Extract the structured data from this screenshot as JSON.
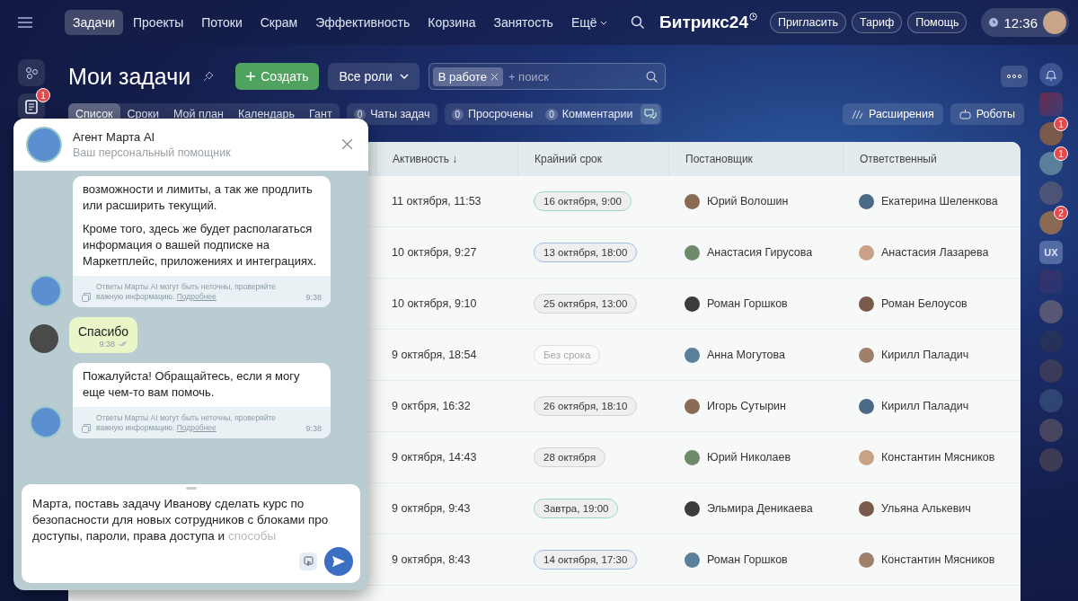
{
  "top_nav": {
    "items": [
      {
        "label": "Задачи",
        "selected": true,
        "dropdown": false
      },
      {
        "label": "Проекты",
        "selected": false,
        "dropdown": false
      },
      {
        "label": "Потоки",
        "selected": false,
        "dropdown": false
      },
      {
        "label": "Скрам",
        "selected": false,
        "dropdown": false
      },
      {
        "label": "Эффективность",
        "selected": false,
        "dropdown": false
      },
      {
        "label": "Корзина",
        "selected": false,
        "dropdown": false
      },
      {
        "label": "Занятость",
        "selected": false,
        "dropdown": false
      },
      {
        "label": "Ещё",
        "selected": false,
        "dropdown": true
      }
    ],
    "logo": "Битрикс24",
    "buttons": [
      "Пригласить",
      "Тариф",
      "Помощь"
    ],
    "time": "12:36"
  },
  "left_sidebar": {
    "items": [
      {
        "kind": "network"
      },
      {
        "kind": "tasks",
        "badge": "1"
      }
    ]
  },
  "header": {
    "title": "Мои задачи",
    "create_button": "Создать",
    "roles_button": "Все роли",
    "filter": {
      "chip": "В работе",
      "placeholder": "+ поиск"
    }
  },
  "view_tabs": [
    {
      "label": "Список",
      "selected": true
    },
    {
      "label": "Сроки",
      "selected": false
    },
    {
      "label": "Мой план",
      "selected": false
    },
    {
      "label": "Календарь",
      "selected": false
    },
    {
      "label": "Гант",
      "selected": false
    }
  ],
  "counters": [
    {
      "count": "0",
      "label": "Чаты задач"
    },
    {
      "count": "0",
      "label": "Просрочены"
    },
    {
      "count": "0",
      "label": "Комментарии"
    }
  ],
  "right_buttons": [
    "Расширения",
    "Роботы"
  ],
  "table": {
    "columns": [
      "Активность ↓",
      "Крайний срок",
      "Постановщик",
      "Ответственный"
    ],
    "rows": [
      {
        "activity": "11 октября, 11:53",
        "deadline": "16 октября, 9:00",
        "color": "#9fd6cc",
        "empty": false,
        "creator": "Юрий Волошин",
        "assignee": "Екатерина Шеленкова"
      },
      {
        "activity": "10 октября, 9:27",
        "deadline": "13 октября, 18:00",
        "color": "#9cc0e6",
        "empty": false,
        "creator": "Анастасия Гирусова",
        "assignee": "Анастасия Лазарева"
      },
      {
        "activity": "10 октября, 9:10",
        "deadline": "25 октября, 13:00",
        "color": "#cfd3d5",
        "empty": false,
        "creator": "Роман Горшков",
        "assignee": "Роман Белоусов"
      },
      {
        "activity": "9 октября, 18:54",
        "deadline": "Без срока",
        "color": "#dde0e2",
        "empty": true,
        "creator": "Анна Могутова",
        "assignee": "Кирилл Паладич"
      },
      {
        "activity": "9 октбря, 16:32",
        "deadline": "26 октября, 18:10",
        "color": "#cfd3d5",
        "empty": false,
        "creator": "Игорь Сутырин",
        "assignee": "Кирилл Паладич"
      },
      {
        "activity": "9 октября, 14:43",
        "deadline": "28 октября",
        "color": "#cfd3d5",
        "empty": false,
        "creator": "Юрий Николаев",
        "assignee": "Константин Мясников"
      },
      {
        "activity": "9 октября, 9:43",
        "deadline": "Завтра, 19:00",
        "color": "#9fd6cc",
        "empty": false,
        "creator": "Эльмира Деникаева",
        "assignee": "Ульяна Алькевич"
      },
      {
        "activity": "9 октября, 8:43",
        "deadline": "14 октября, 17:30",
        "color": "#9cc0e6",
        "empty": false,
        "creator": "Роман Горшков",
        "assignee": "Константин Мясников"
      }
    ]
  },
  "right_sidebar": {
    "items": [
      {
        "kind": "bell",
        "faded": false
      },
      {
        "kind": "tile",
        "faded": false
      },
      {
        "kind": "avatar",
        "badge": "1",
        "faded": false
      },
      {
        "kind": "avatar",
        "badge": "1",
        "faded": false
      },
      {
        "kind": "avatar",
        "faded": true
      },
      {
        "kind": "avatar",
        "badge": "2",
        "faded": false
      },
      {
        "kind": "text_tile",
        "label": "UX",
        "faded": false
      },
      {
        "kind": "tile",
        "faded": true
      },
      {
        "kind": "avatar",
        "faded": true
      },
      {
        "kind": "avatar",
        "faded": true
      },
      {
        "kind": "avatar",
        "faded": true
      },
      {
        "kind": "avatar",
        "faded": true
      },
      {
        "kind": "avatar",
        "faded": true
      },
      {
        "kind": "avatar",
        "faded": true
      }
    ]
  },
  "chat": {
    "title": "Агент Марта AI",
    "subtitle": "Ваш персональный помощник",
    "messages": [
      {
        "kind": "bot",
        "paragraphs": [
          "возможности и лимиты, а так же продлить или расширить текущий.",
          "Кроме того, здесь же будет располагаться информация о вашей подписке на Маркетплейс, приложениях и интеграциях."
        ],
        "disclaimer": "Ответы Марты AI могут быть неточны, проверяйте важную информацию.",
        "link": "Подробнее",
        "time": "9:38"
      },
      {
        "kind": "user",
        "paragraphs": [
          "Спасибо"
        ],
        "time": "9:38",
        "read": true
      },
      {
        "kind": "bot",
        "paragraphs": [
          "Пожалуйста! Обращайтесь, если я могу еще чем-то вам помочь."
        ],
        "disclaimer": "Ответы Марты AI могут быть неточны, проверяйте важную информацию.",
        "link": "Подробнее",
        "time": "9:38"
      }
    ],
    "input": {
      "value": "Марта, поставь задачу Иванову сделать курс по безопасности для новых сотрудников с блоками про доступы, пароли, права доступа и",
      "pending": "способы"
    }
  }
}
